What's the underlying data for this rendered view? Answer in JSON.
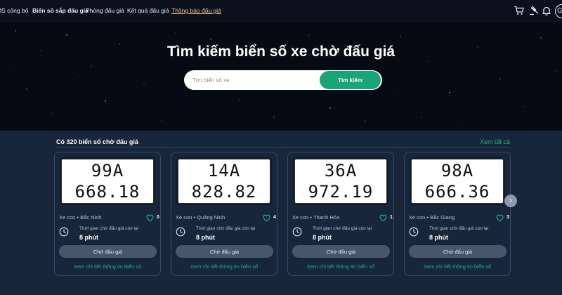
{
  "nav": {
    "items": [
      {
        "label": "DS công bố"
      },
      {
        "label": "Biển số sắp đấu giá"
      },
      {
        "label": "Phòng đấu giá"
      },
      {
        "label": "Kết quả đấu giá"
      },
      {
        "label": "Thông báo đấu giá"
      }
    ],
    "avatar_letter": "G",
    "icons": [
      "cart-icon",
      "gavel-icon",
      "bell-icon"
    ]
  },
  "hero": {
    "title": "Tìm kiếm biển số xe chờ đấu giá",
    "search_placeholder": "Tìm biển số xe",
    "search_value": "",
    "search_button": "Tìm kiếm"
  },
  "listing": {
    "count_text": "Có 320 biển số chờ đấu giá",
    "view_all": "Xem tất cả",
    "cards": [
      {
        "plate_line1": "99A",
        "plate_line2": "668.18",
        "meta": "Xe con • Bắc Ninh",
        "likes": "0",
        "time_label": "Thời gian chờ đấu giá còn lại",
        "time_value": "8 phút",
        "status": "Chờ đấu giá",
        "detail": "Xem chi tiết thông tin biển số"
      },
      {
        "plate_line1": "14A",
        "plate_line2": "828.82",
        "meta": "Xe con • Quảng Ninh",
        "likes": "4",
        "time_label": "Thời gian chờ đấu giá còn lại",
        "time_value": "8 phút",
        "status": "Chờ đấu giá",
        "detail": "Xem chi tiết thông tin biển số"
      },
      {
        "plate_line1": "36A",
        "plate_line2": "972.19",
        "meta": "Xe con • Thanh Hóa",
        "likes": "1",
        "time_label": "Thời gian chờ đấu giá còn lại",
        "time_value": "8 phút",
        "status": "Chờ đấu giá",
        "detail": "Xem chi tiết thông tin biển số"
      },
      {
        "plate_line1": "98A",
        "plate_line2": "666.36",
        "meta": "Xe con • Bắc Giang",
        "likes": "3",
        "time_label": "Thời gian chờ đấu giá còn lại",
        "time_value": "8 phút",
        "status": "Chờ đấu giá",
        "detail": "Xem chi tiết thông tin biển số"
      }
    ],
    "next_icon": "chevron-right-icon"
  },
  "colors": {
    "accent": "#1aa47a",
    "link": "#1fb584",
    "active_nav": "#f0c48a",
    "background": "#17263a",
    "hero_background": "#060a12"
  }
}
